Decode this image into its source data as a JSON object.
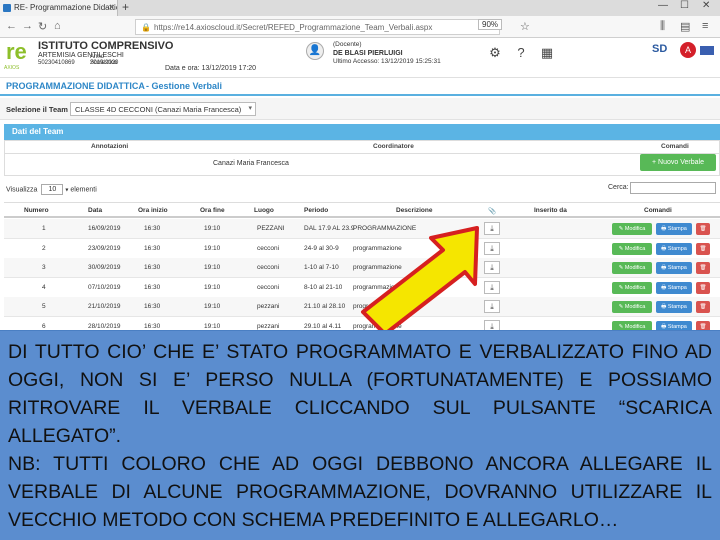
{
  "browser": {
    "tab_title": "RE- Programmazione Didattica",
    "tab_close": "×",
    "new_tab": "+",
    "url": "https://re14.axioscloud.it/Secret/REFED_Programmazione_Team_Verbali.aspx",
    "zoom": "90%",
    "window_min": "—",
    "window_max": "☐",
    "window_close": "✕",
    "back": "←",
    "forward": "→",
    "reload": "↻",
    "home": "⌂"
  },
  "school": {
    "logo": "re",
    "logo_sub": "AXIOS",
    "name": "ISTITUTO COMPRENSIVO",
    "subname": "ARTEMISIA GENTILESCHI",
    "code1": "50230410869",
    "year_label": "Anno Scolastico",
    "year": "2019/2020",
    "date": "Data e ora: 13/12/2019 17:20",
    "user_role": "(Docente)",
    "user_name": "DE BLASI PIERLUIGI",
    "user_access": "Ultimo Accesso: 13/12/2019 15:25:31",
    "brand": "SD",
    "brand_badge": "A"
  },
  "module": {
    "title": "PROGRAMMAZIONE DIDATTICA",
    "subtitle": "- Gestione Verbali"
  },
  "team_selector": {
    "label": "Selezione il Team",
    "value": "CLASSE 4D CECCONI (Canazi Maria Francesca)"
  },
  "team_panel": {
    "title": "Dati del Team",
    "col_annotazioni": "Annotazioni",
    "col_coordinatore": "Coordinatore",
    "col_comandi": "Comandi",
    "coordinatore": "Canazi Maria Francesca",
    "new_button": "+ Nuovo Verbale"
  },
  "controls": {
    "show_label": "Visualizza",
    "show_value": "10",
    "show_suffix": "elementi",
    "search_label": "Cerca:"
  },
  "table": {
    "headers": [
      "Numero",
      "Data",
      "Ora inizio",
      "Ora fine",
      "Luogo",
      "Periodo",
      "Descrizione",
      "📎",
      "Inserito da",
      "Comandi"
    ],
    "rows": [
      {
        "num": "1",
        "date": "16/09/2019",
        "start": "16:30",
        "end": "19:10",
        "place": "PEZZANI",
        "period": "DAL 17.9 AL 23.9",
        "desc": "PROGRAMMAZIONE"
      },
      {
        "num": "2",
        "date": "23/09/2019",
        "start": "16:30",
        "end": "19:10",
        "place": "cecconi",
        "period": "24-9 al 30-9",
        "desc": "programmazione"
      },
      {
        "num": "3",
        "date": "30/09/2019",
        "start": "16:30",
        "end": "19:10",
        "place": "cecconi",
        "period": "1-10 al 7-10",
        "desc": "programmazione"
      },
      {
        "num": "4",
        "date": "07/10/2019",
        "start": "16:30",
        "end": "19:10",
        "place": "cecconi",
        "period": "8-10 al 21-10",
        "desc": "programmazione settimanale"
      },
      {
        "num": "5",
        "date": "21/10/2019",
        "start": "16:30",
        "end": "19:10",
        "place": "pezzani",
        "period": "21.10 al 28.10",
        "desc": "programmazione"
      },
      {
        "num": "6",
        "date": "28/10/2019",
        "start": "16:30",
        "end": "19:10",
        "place": "pezzani",
        "period": "29.10 al 4.11",
        "desc": "programmazione"
      }
    ],
    "download_icon": "⤓",
    "btn_modifica": "✎ Modifica",
    "btn_stampa": "🖶 Stampa",
    "btn_delete": "🗑"
  },
  "caption": {
    "text": "DI TUTTO CIO’ CHE E’ STATO PROGRAMMATO E VERBALIZZATO FINO AD OGGI, NON SI E’ PERSO NULLA (FORTUNATAMENTE) E POSSIAMO RITROVARE IL VERBALE CLICCANDO SUL PULSANTE “SCARICA ALLEGATO”.",
    "note": "NB: TUTTI COLORO CHE AD OGGI DEBBONO ANCORA ALLEGARE IL VERBALE DI ALCUNE PROGRAMMAZIONE, DOVRANNO UTILIZZARE IL VECCHIO METODO CON SCHEMA PREDEFINITO E ALLEGARLO…"
  },
  "colors": {
    "accent": "#2e87c7",
    "panel": "#5bb4e4",
    "green": "#58b957",
    "blue": "#3f8ad0",
    "red": "#d9534f",
    "caption_bg": "#5b8dcf",
    "arrow_fill": "#f5e600",
    "arrow_stroke": "#d62020"
  }
}
